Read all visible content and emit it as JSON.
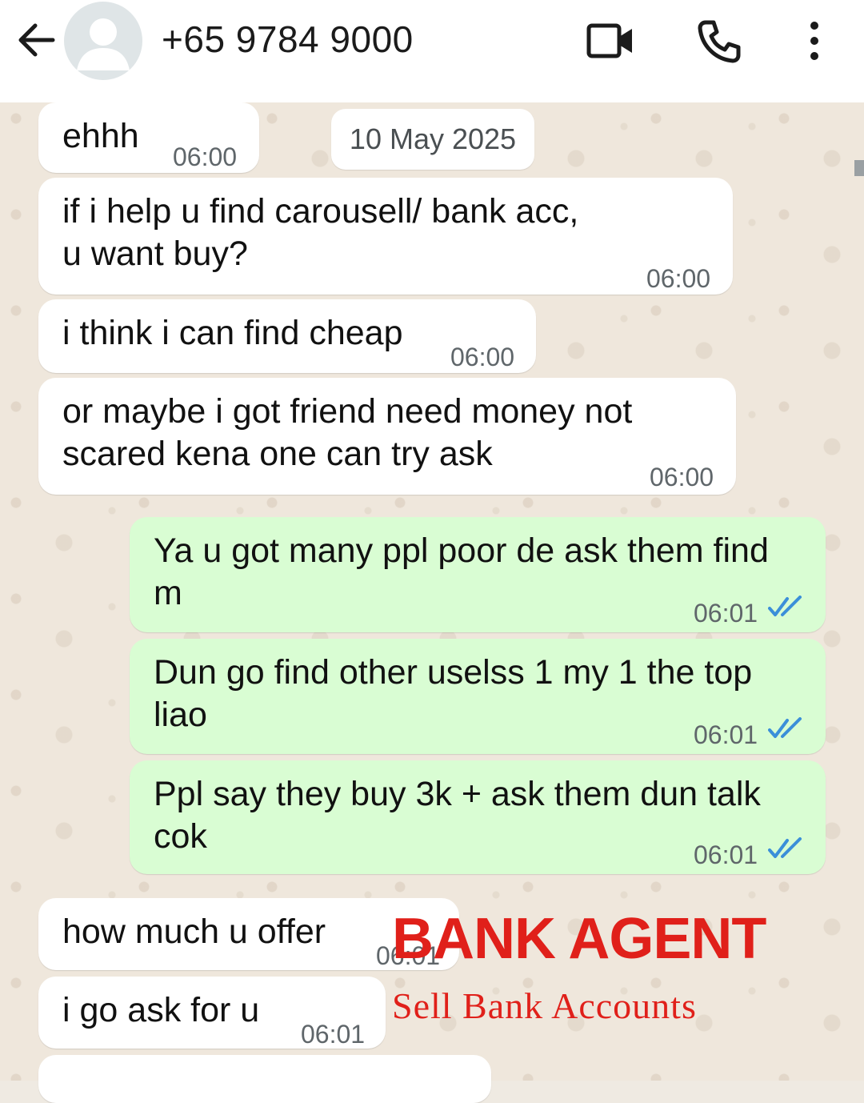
{
  "header": {
    "contact": "+65 9784 9000",
    "icons": [
      "back-arrow-icon",
      "avatar-placeholder-icon",
      "video-call-icon",
      "phone-icon",
      "more-vertical-icon"
    ]
  },
  "date_chip": "10 May 2025",
  "messages": [
    {
      "dir": "in",
      "text": "ehhh",
      "time": "06:00"
    },
    {
      "dir": "in",
      "text": "if i help u find carousell/ bank acc,\nu want buy?",
      "time": "06:00"
    },
    {
      "dir": "in",
      "text": "i think i can find cheap",
      "time": "06:00"
    },
    {
      "dir": "in",
      "text": "or maybe i got friend need money not\nscared kena one can try ask",
      "time": "06:00"
    },
    {
      "dir": "out",
      "text": "Ya u got many ppl poor de ask them find\nm",
      "time": "06:01",
      "status": "read"
    },
    {
      "dir": "out",
      "text": "Dun go find other uselss 1 my 1 the top\nliao",
      "time": "06:01",
      "status": "read"
    },
    {
      "dir": "out",
      "text": "Ppl say they buy 3k + ask them dun talk\ncok",
      "time": "06:01",
      "status": "read"
    },
    {
      "dir": "in",
      "text": "how much u offer",
      "time": "06:01"
    },
    {
      "dir": "in",
      "text": "i go ask for u",
      "time": "06:01"
    }
  ],
  "watermark": {
    "title": "BANK AGENT",
    "subtitle": "Sell Bank Accounts",
    "color": "#e0201a"
  },
  "colors": {
    "incoming_bubble": "#ffffff",
    "outgoing_bubble": "#d9fdd3",
    "read_ticks": "#3b8fd9"
  }
}
